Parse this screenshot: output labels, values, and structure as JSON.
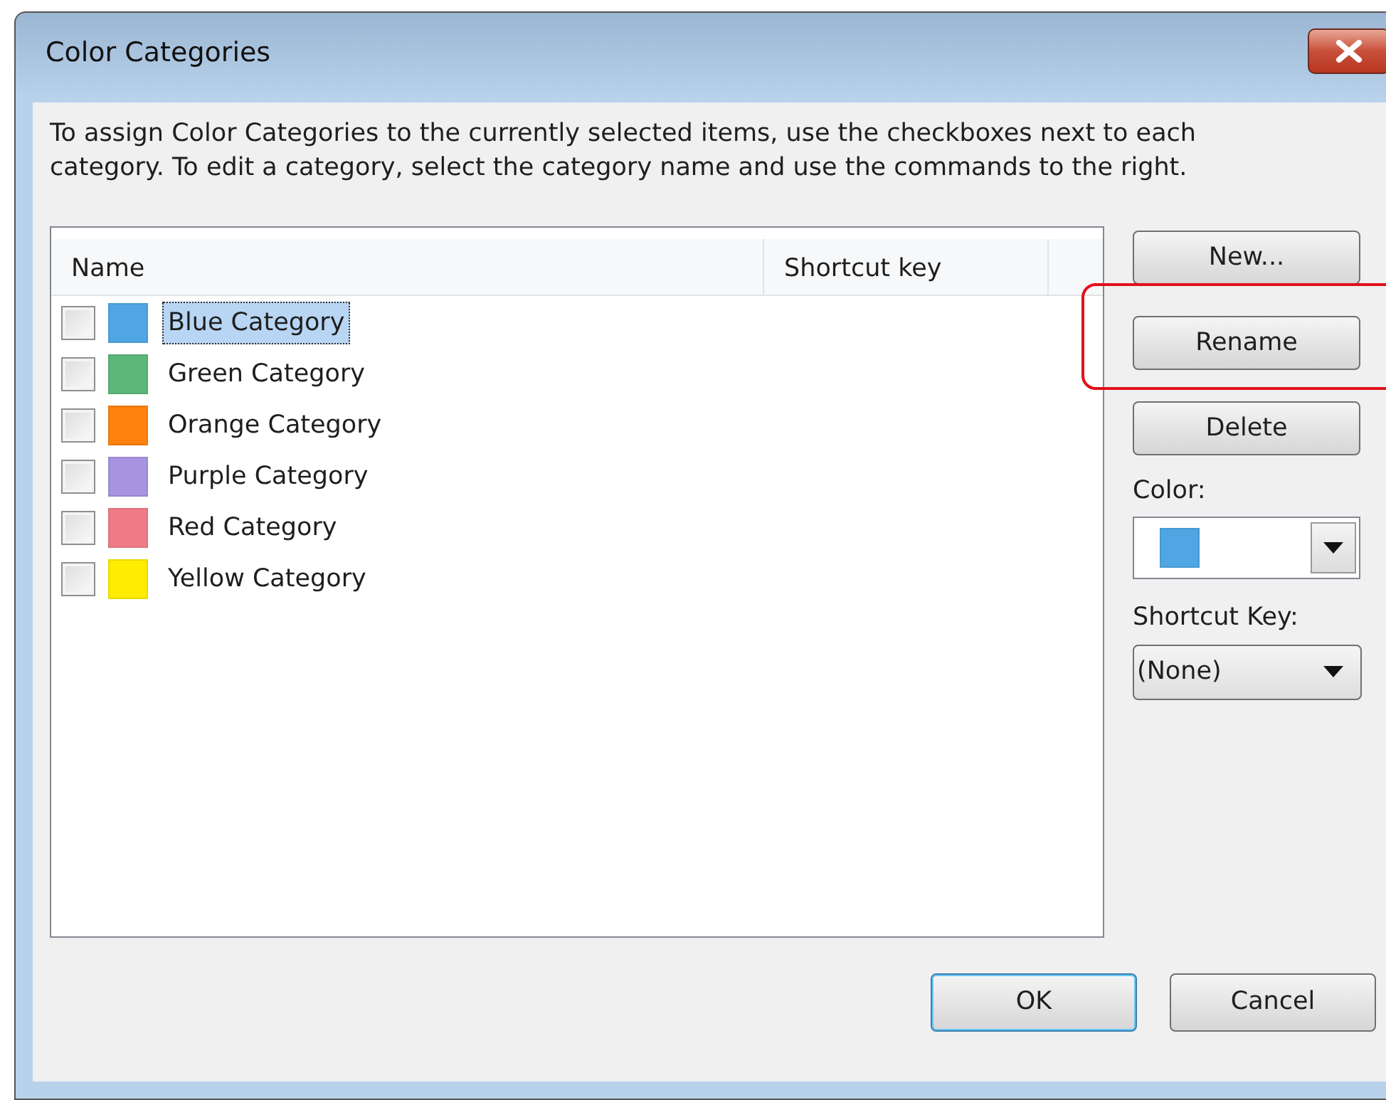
{
  "window": {
    "title": "Color Categories"
  },
  "instructions": "To assign Color Categories to the currently selected items, use the checkboxes next to each category.  To edit a category, select the category name and use the commands to the right.",
  "list": {
    "columns": [
      "Name",
      "Shortcut key"
    ],
    "rows": [
      {
        "name": "Blue Category",
        "color": "#4fa6e3",
        "checked": false,
        "selected": true
      },
      {
        "name": "Green Category",
        "color": "#5cb879",
        "checked": false,
        "selected": false
      },
      {
        "name": "Orange Category",
        "color": "#ff8210",
        "checked": false,
        "selected": false
      },
      {
        "name": "Purple Category",
        "color": "#a794e0",
        "checked": false,
        "selected": false
      },
      {
        "name": "Red Category",
        "color": "#ef7b86",
        "checked": false,
        "selected": false
      },
      {
        "name": "Yellow Category",
        "color": "#ffec00",
        "checked": false,
        "selected": false
      }
    ]
  },
  "side_buttons": [
    {
      "label": "New...",
      "highlighted": false
    },
    {
      "label": "Rename",
      "highlighted": true
    },
    {
      "label": "Delete",
      "highlighted": false
    }
  ],
  "color_field": {
    "label": "Color:",
    "color": "#4fa6e3"
  },
  "shortcut_field": {
    "label": "Shortcut Key:",
    "value": "(None)"
  },
  "footer_buttons": [
    {
      "label": "OK",
      "default": true
    },
    {
      "label": "Cancel",
      "default": false
    }
  ]
}
